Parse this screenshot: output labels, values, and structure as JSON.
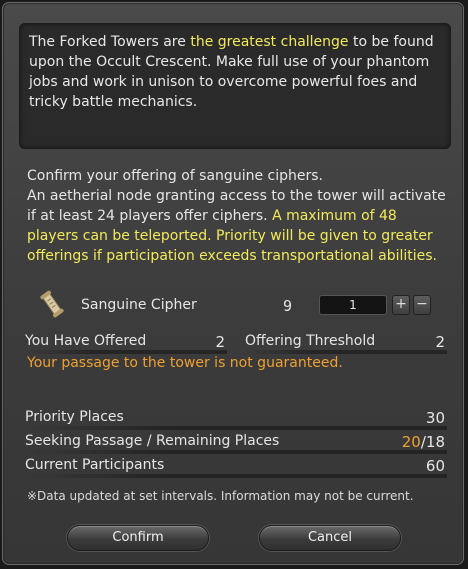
{
  "description": {
    "part1": "The Forked Towers are ",
    "highlight": "the greatest challenge",
    "part2": " to be found upon the Occult Crescent. Make full use of your phantom jobs and work in unison to overcome powerful foes and tricky battle mechanics."
  },
  "confirm": {
    "line1": "Confirm your offering of sanguine ciphers.",
    "line2": "An aetherial node granting access to the tower will activate if at least 24 players offer ciphers. ",
    "highlight": "A maximum of 48 players can be teleported. Priority will be given to greater offerings if participation exceeds transportational abilities."
  },
  "item": {
    "icon": "scroll-icon",
    "name": "Sanguine Cipher",
    "owned": "9",
    "quantity": "1",
    "plus": "+",
    "minus": "−"
  },
  "offer": {
    "you_have_offered_label": "You Have Offered",
    "you_have_offered_value": "2",
    "threshold_label": "Offering Threshold",
    "threshold_value": "2",
    "warning": "Your passage to the tower is not guaranteed."
  },
  "stats": {
    "priority_label": "Priority Places",
    "priority_value": "30",
    "seeking_label": "Seeking Passage / Remaining Places",
    "seeking_value": "20",
    "seeking_sep": "/",
    "remaining_value": "18",
    "current_label": "Current Participants",
    "current_value": "60"
  },
  "note": "※Data updated at set intervals. Information may not be current.",
  "buttons": {
    "confirm": "Confirm",
    "cancel": "Cancel"
  },
  "colors": {
    "highlight": "#f3ea5b",
    "warning": "#f0a030"
  }
}
